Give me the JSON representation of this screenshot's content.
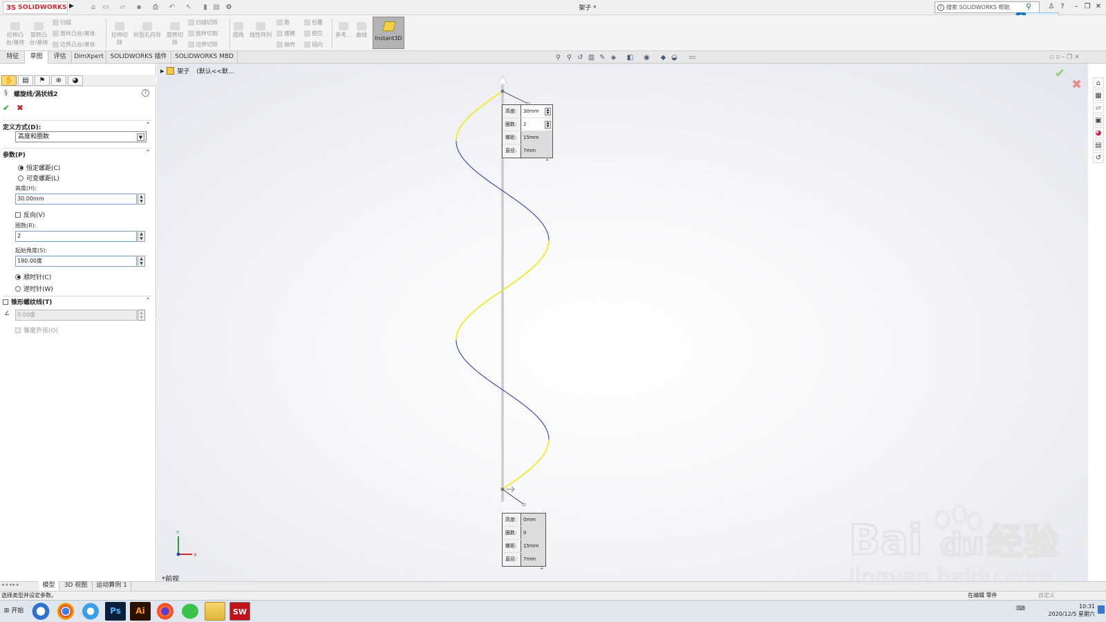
{
  "app": {
    "logo_prefix": "3S",
    "logo_text": "SOLIDWORKS",
    "document_title": "架子 *",
    "help_search_placeholder": "搜索 SOLIDWORKS 帮助"
  },
  "command_manager": {
    "extrude_boss": "拉伸凸\n台/基体",
    "revolve_boss": "旋转凸\n台/基体",
    "sweep": "扫描",
    "loft_boss": "放样凸台/基体",
    "boundary_boss": "边界凸台/基体",
    "extrude_cut": "拉伸切\n除",
    "hole_wizard": "异型孔向导",
    "revolve_cut": "旋转切\n除",
    "swept_cut": "扫描切除",
    "lofted_cut": "放样切割",
    "boundary_cut": "边界切除",
    "fillet": "圆角",
    "linear_pattern": "线性阵列",
    "rib": "筋",
    "draft": "拔模",
    "shell": "抽壳",
    "wrap": "包覆",
    "intersect": "相交",
    "mirror": "镜向",
    "reference": "参考...",
    "curves": "曲线",
    "instant3d": "Instant3D"
  },
  "tabs": [
    "特征",
    "草图",
    "评估",
    "DimXpert",
    "SOLIDWORKS 插件",
    "SOLIDWORKS MBD"
  ],
  "active_tab": 0,
  "property_manager": {
    "title": "螺旋线/涡状线2",
    "definition_group": "定义方式(D):",
    "definition_value": "高度和圈数",
    "params_group": "参数(P)",
    "constant_pitch": "恒定螺距(C)",
    "variable_pitch": "可变螺距(L)",
    "height_label": "高度(H):",
    "height_value": "30.00mm",
    "reverse_label": "反向(V)",
    "revolutions_label": "圈数(R):",
    "revolutions_value": "2",
    "start_angle_label": "起始角度(S):",
    "start_angle_value": "180.00度",
    "clockwise": "顺时针(C)",
    "counterclockwise": "逆时针(W)",
    "taper_group": "锥形螺纹线(T)",
    "taper_angle_value": "0.00度",
    "taper_outward": "锥度外张(O)"
  },
  "tree": {
    "part_name": "架子",
    "config": "(默认<<默..."
  },
  "callout_top": {
    "rows": [
      {
        "k": "高度:",
        "v": "30mm",
        "spinner": true
      },
      {
        "k": "圈数:",
        "v": "2",
        "spinner": true
      },
      {
        "k": "螺距:",
        "v": "15mm",
        "spinner": false
      },
      {
        "k": "直径:",
        "v": "7mm",
        "spinner": false
      }
    ]
  },
  "callout_bottom": {
    "rows": [
      {
        "k": "高度:",
        "v": "0mm"
      },
      {
        "k": "圈数:",
        "v": "0"
      },
      {
        "k": "螺距:",
        "v": "15mm"
      },
      {
        "k": "直径:",
        "v": "7mm"
      }
    ]
  },
  "view_name": "*前视",
  "triad": {
    "y": "Y",
    "x": "X"
  },
  "bottom_tabs": [
    "模型",
    "3D 视图",
    "运动算例 1"
  ],
  "status": {
    "message": "选择类型并设定参数。",
    "editing": "在编辑 零件",
    "custom": "自定义"
  },
  "taskbar": {
    "start": "开始",
    "time": "10:31",
    "date": "2020/12/5 星期六"
  },
  "watermark": {
    "brand": "Bai",
    "brand_du": "du",
    "brand_cn": "经验",
    "url": "jingyan.baidu.com"
  },
  "colors": {
    "helix_front": "#f2ea22",
    "helix_back": "#3a3ab8",
    "accent_red": "#d8222a"
  }
}
